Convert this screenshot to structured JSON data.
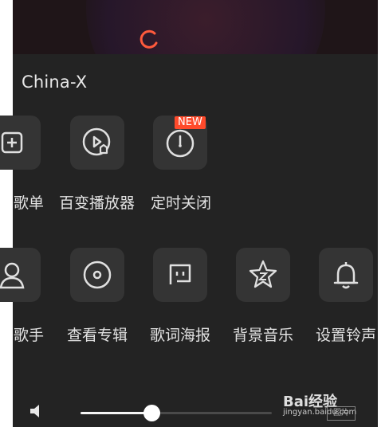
{
  "song": {
    "title": "China-X"
  },
  "row1": [
    {
      "label": "歌单",
      "icon": "playlist-add-icon"
    },
    {
      "label": "百变播放器",
      "icon": "player-skin-icon"
    },
    {
      "label": "定时关闭",
      "icon": "timer-icon",
      "badge": "NEW"
    }
  ],
  "row2": [
    {
      "label": "歌手",
      "icon": "singer-icon"
    },
    {
      "label": "查看专辑",
      "icon": "album-icon"
    },
    {
      "label": "歌词海报",
      "icon": "lyrics-poster-icon"
    },
    {
      "label": "背景音乐",
      "icon": "background-music-icon"
    },
    {
      "label": "设置铃声",
      "icon": "ringtone-icon"
    }
  ],
  "volume": {
    "level": 0.38,
    "icon": "volume-icon"
  },
  "watermark": {
    "main": "Bai经验",
    "sub": "jingyan.baidu.com",
    "box": "图片"
  },
  "colors": {
    "accent": "#ff4a2b",
    "panel": "#232323",
    "tile": "#343434"
  }
}
